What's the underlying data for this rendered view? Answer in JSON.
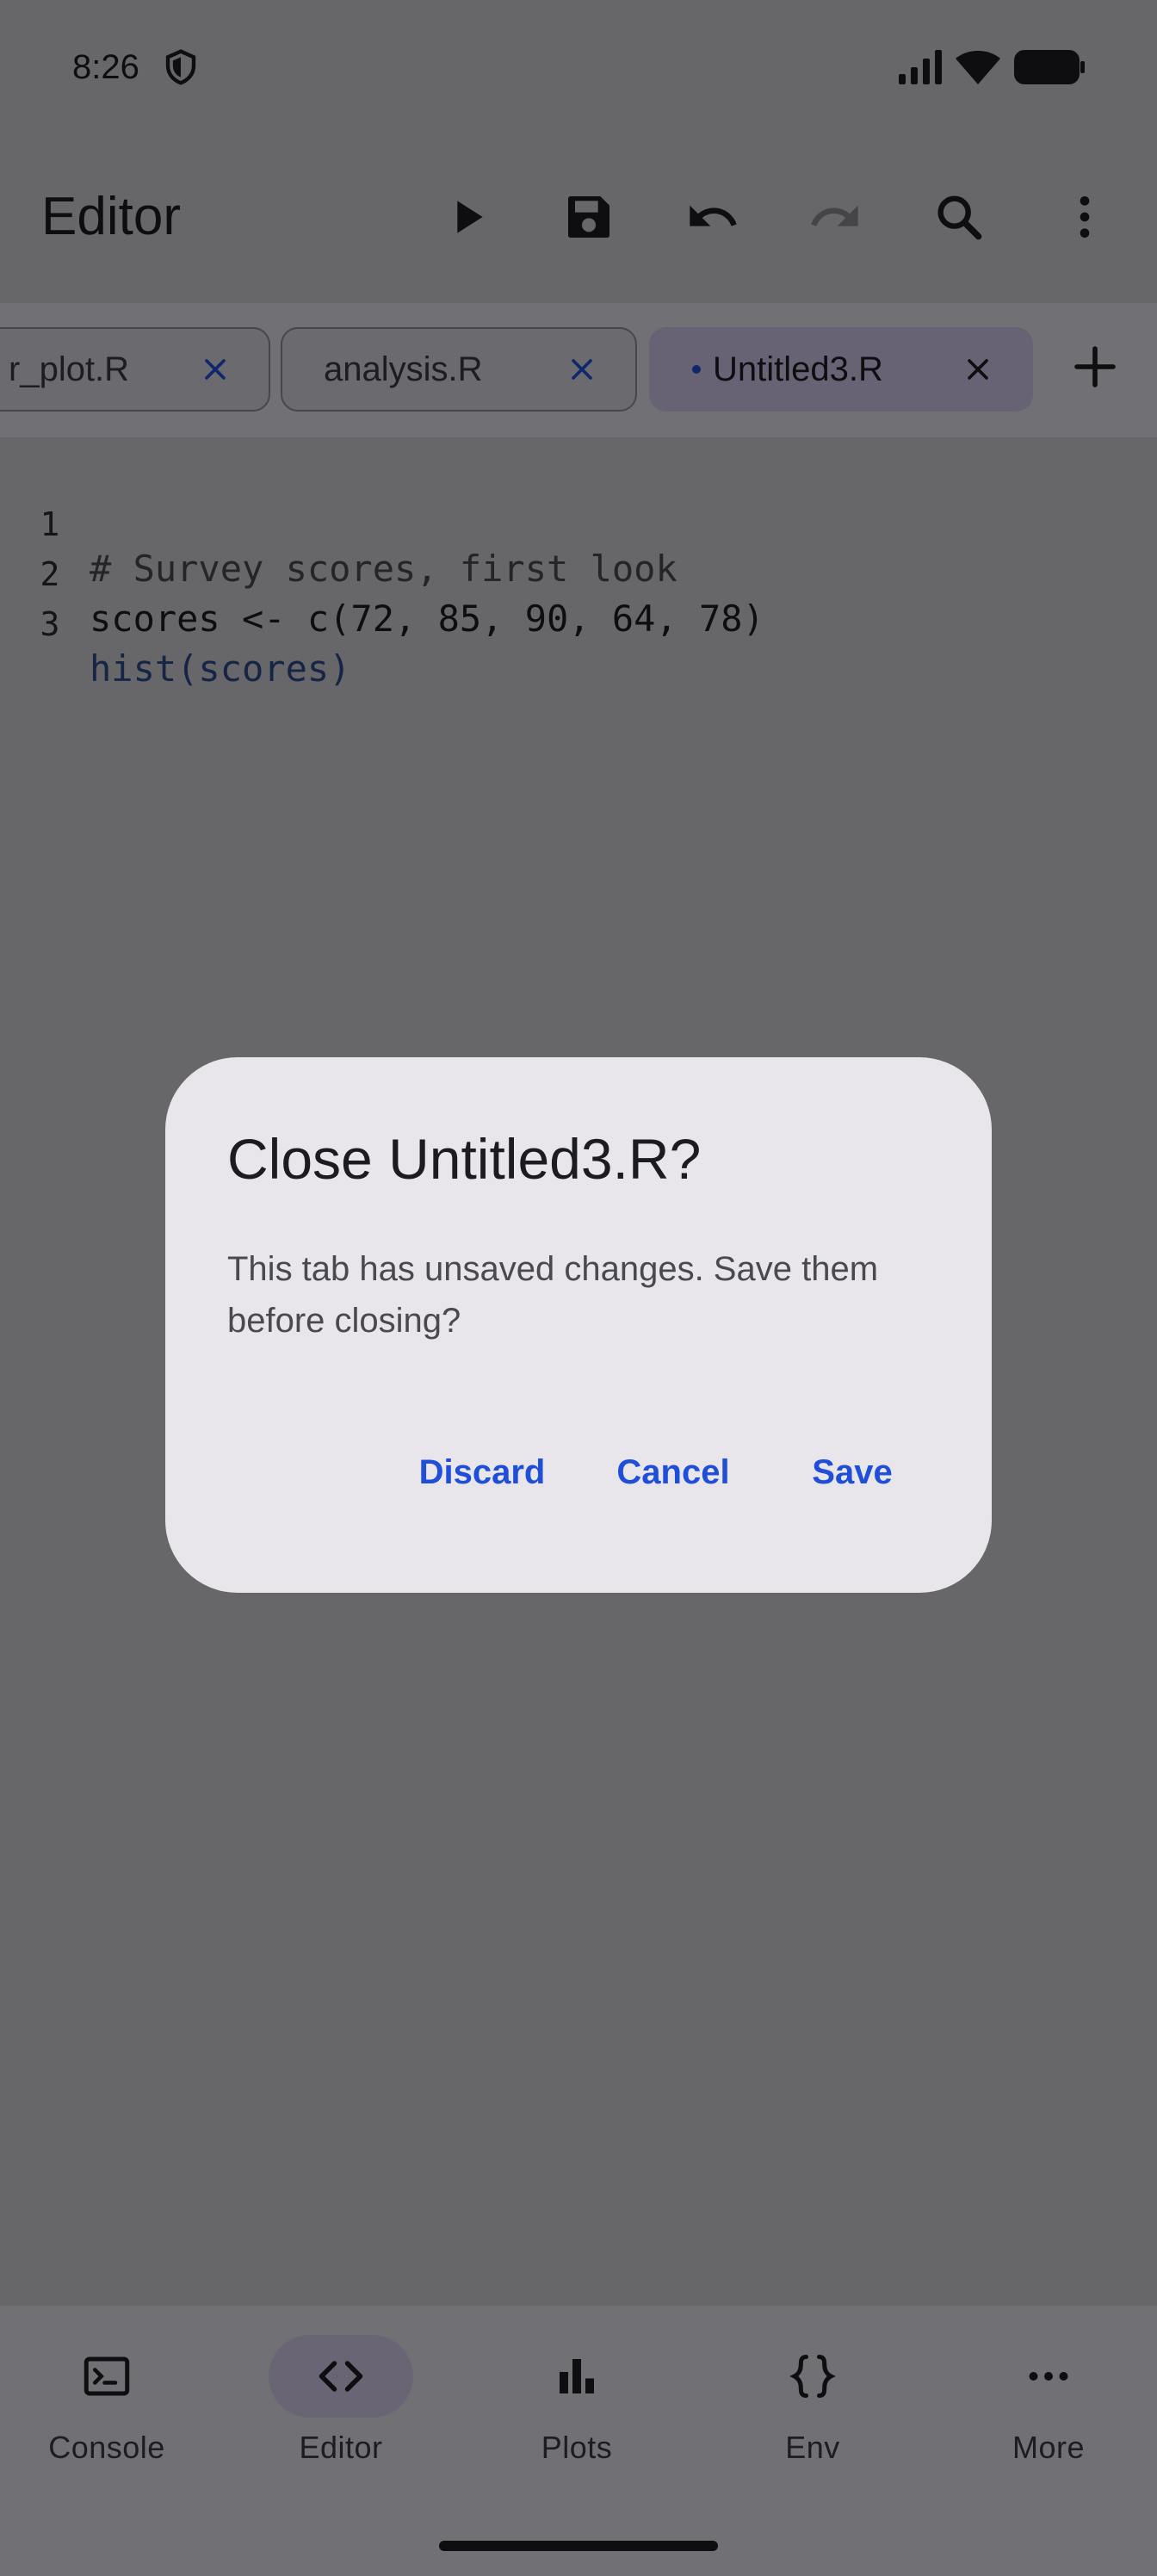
{
  "status_bar": {
    "time": "8:26"
  },
  "app_bar": {
    "title": "Editor"
  },
  "tabs": [
    {
      "label": "r_plot.R",
      "active": false,
      "unsaved": false
    },
    {
      "label": "analysis.R",
      "active": false,
      "unsaved": false
    },
    {
      "label": "Untitled3.R",
      "active": true,
      "unsaved": true
    }
  ],
  "code": {
    "lines": [
      {
        "num": "1",
        "text": "# Survey scores, first look"
      },
      {
        "num": "2",
        "text": "scores <- c(72, 85, 90, 64, 78)"
      },
      {
        "num": "3",
        "text": "hist(scores)"
      }
    ]
  },
  "bottom_nav": {
    "items": [
      {
        "label": "Console",
        "icon": "console-icon"
      },
      {
        "label": "Editor",
        "icon": "code-icon",
        "active": true
      },
      {
        "label": "Plots",
        "icon": "bar-chart-icon"
      },
      {
        "label": "Env",
        "icon": "braces-icon"
      },
      {
        "label": "More",
        "icon": "more-horizontal-icon"
      }
    ]
  },
  "dialog": {
    "title": "Close Untitled3.R?",
    "body": "This tab has unsaved changes. Save them before closing?",
    "discard_label": "Discard",
    "cancel_label": "Cancel",
    "save_label": "Save"
  },
  "colors": {
    "accent": "#1f4fd8",
    "scrim": "rgba(0,0,0,0.5)",
    "dialog_bg": "#e8e6eb",
    "surface": "#cecdd1"
  }
}
